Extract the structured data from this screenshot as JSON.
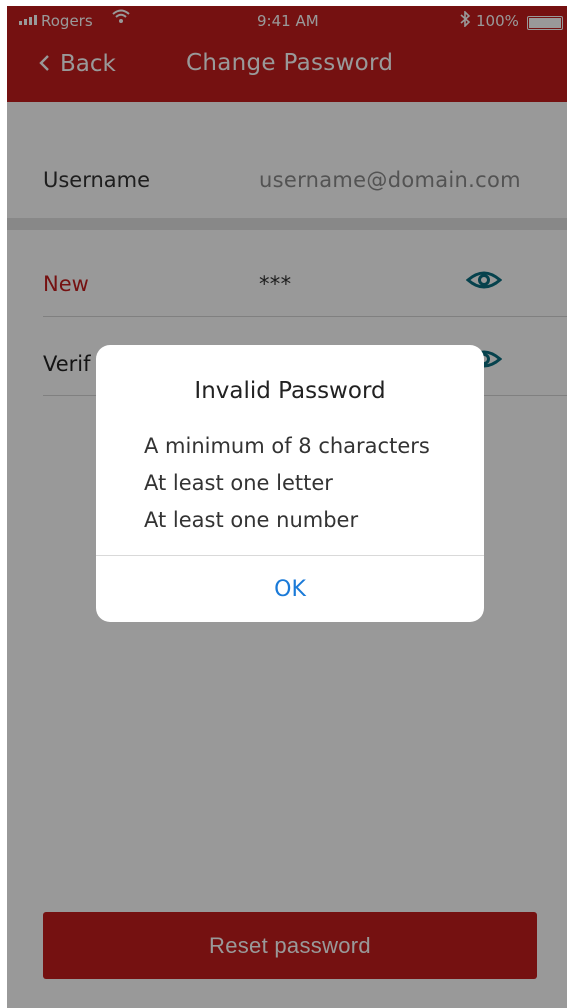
{
  "status_bar": {
    "carrier": "Rogers",
    "time": "9:41 AM",
    "battery": "100%"
  },
  "nav": {
    "back_label": "Back",
    "title": "Change Password"
  },
  "form": {
    "username_label": "Username",
    "username_value": "username@domain.com",
    "new_label": "New",
    "new_value": "***",
    "verify_label": "Verif"
  },
  "reset_button_label": "Reset password",
  "alert": {
    "title": "Invalid Password",
    "lines": [
      "A minimum of 8 characters",
      "At least one letter",
      "At least one number"
    ],
    "ok_label": "OK"
  },
  "colors": {
    "brand_red": "#c41d1d",
    "link_blue": "#1a7ad8",
    "eye_teal": "#0b6f80"
  },
  "icons": [
    "signal-icon",
    "wifi-icon",
    "bluetooth-icon",
    "battery-icon",
    "chevron-left-icon",
    "eye-icon"
  ]
}
